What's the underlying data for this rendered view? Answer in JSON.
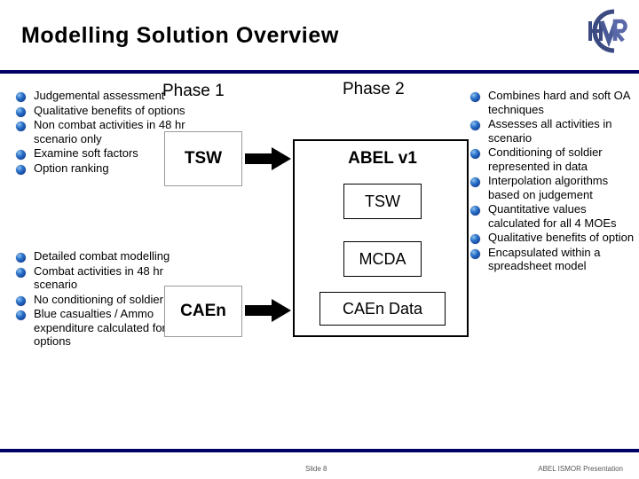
{
  "slide": {
    "title": "Modelling Solution Overview",
    "logo_text": "HVR",
    "accent_color": "#000066"
  },
  "phases": {
    "phase1_label": "Phase 1",
    "phase2_label": "Phase 2"
  },
  "diagram": {
    "tsw_left": "TSW",
    "caen_left": "CAEn",
    "abel_title": "ABEL v1",
    "abel_children": [
      "TSW",
      "MCDA",
      "CAEn Data"
    ]
  },
  "left_column_top": [
    "Judgemental assessment",
    "Qualitative benefits of options",
    "Non combat activities in 48 hr scenario only",
    "Examine soft factors",
    "Option ranking"
  ],
  "left_column_bottom": [
    "Detailed combat modelling",
    "Combat activities in 48 hr scenario",
    "No conditioning of soldier",
    "Blue casualties / Ammo expenditure calculated for options"
  ],
  "right_column": [
    "Combines hard and soft OA techniques",
    "Assesses all activities in scenario",
    "Conditioning of soldier represented in data",
    "Interpolation algorithms based on judgement",
    "Quantitative values calculated for all 4 MOEs",
    "Qualitative benefits of option",
    "Encapsulated within a spreadsheet model"
  ],
  "footer": {
    "slide_number": "Slide 8",
    "presentation_name": "ABEL ISMOR Presentation"
  }
}
